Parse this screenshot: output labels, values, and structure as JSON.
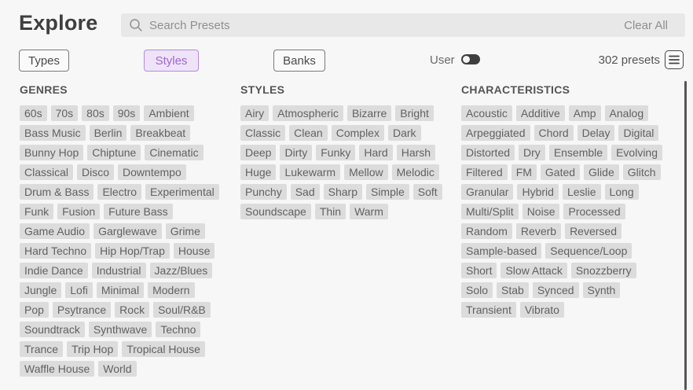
{
  "header": {
    "title": "Explore",
    "search_placeholder": "Search Presets",
    "clear_all": "Clear All"
  },
  "tabs": [
    {
      "label": "Types",
      "active": false
    },
    {
      "label": "Styles",
      "active": true
    },
    {
      "label": "Banks",
      "active": false
    }
  ],
  "user_filter": {
    "label": "User",
    "enabled": false
  },
  "preset_count": "302 presets",
  "icons": {
    "search": "search-icon",
    "menu": "hamburger-menu-icon"
  },
  "colors": {
    "accent": "#a066d6",
    "tag_bg": "#dcdcdc",
    "background": "#f7f7f7"
  },
  "genres": {
    "heading": "GENRES",
    "rows": [
      [
        "60s",
        "70s",
        "80s",
        "90s",
        "Ambient"
      ],
      [
        "Bass Music",
        "Berlin",
        "Breakbeat"
      ],
      [
        "Bunny Hop",
        "Chiptune",
        "Cinematic"
      ],
      [
        "Classical",
        "Disco",
        "Downtempo"
      ],
      [
        "Drum & Bass",
        "Electro",
        "Experimental"
      ],
      [
        "Funk",
        "Fusion",
        "Future Bass"
      ],
      [
        "Game Audio",
        "Garglewave",
        "Grime"
      ],
      [
        "Hard Techno",
        "Hip Hop/Trap",
        "House"
      ],
      [
        "Indie Dance",
        "Industrial",
        "Jazz/Blues"
      ],
      [
        "Jungle",
        "Lofi",
        "Minimal",
        "Modern"
      ],
      [
        "Pop",
        "Psytrance",
        "Rock",
        "Soul/R&B"
      ],
      [
        "Soundtrack",
        "Synthwave",
        "Techno"
      ],
      [
        "Trance",
        "Trip Hop",
        "Tropical House"
      ],
      [
        "Waffle House",
        "World"
      ]
    ]
  },
  "styles": {
    "heading": "STYLES",
    "rows": [
      [
        "Airy",
        "Atmospheric",
        "Bizarre",
        "Bright"
      ],
      [
        "Classic",
        "Clean",
        "Complex",
        "Dark"
      ],
      [
        "Deep",
        "Dirty",
        "Funky",
        "Hard",
        "Harsh"
      ],
      [
        "Huge",
        "Lukewarm",
        "Mellow",
        "Melodic"
      ],
      [
        "Punchy",
        "Sad",
        "Sharp",
        "Simple",
        "Soft"
      ],
      [
        "Soundscape",
        "Thin",
        "Warm"
      ]
    ]
  },
  "characteristics": {
    "heading": "CHARACTERISTICS",
    "rows": [
      [
        "Acoustic",
        "Additive",
        "Amp",
        "Analog"
      ],
      [
        "Arpeggiated",
        "Chord",
        "Delay",
        "Digital"
      ],
      [
        "Distorted",
        "Dry",
        "Ensemble",
        "Evolving"
      ],
      [
        "Filtered",
        "FM",
        "Gated",
        "Glide",
        "Glitch"
      ],
      [
        "Granular",
        "Hybrid",
        "Leslie",
        "Long"
      ],
      [
        "Multi/Split",
        "Noise",
        "Processed"
      ],
      [
        "Random",
        "Reverb",
        "Reversed"
      ],
      [
        "Sample-based",
        "Sequence/Loop"
      ],
      [
        "Short",
        "Slow Attack",
        "Snozzberry"
      ],
      [
        "Solo",
        "Stab",
        "Synced",
        "Synth"
      ],
      [
        "Transient",
        "Vibrato"
      ]
    ]
  }
}
